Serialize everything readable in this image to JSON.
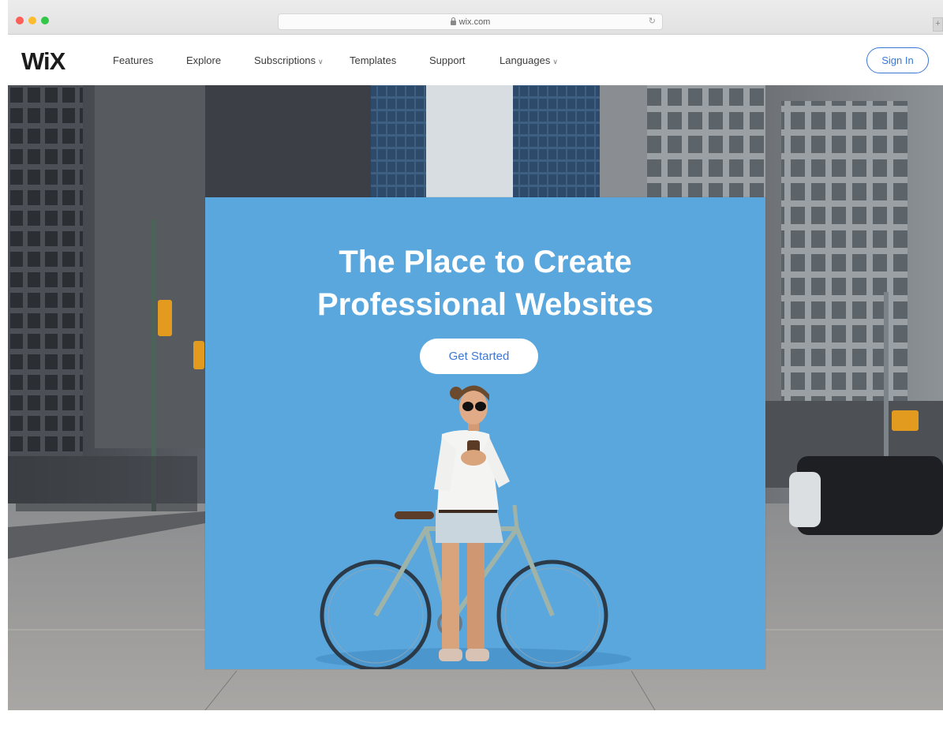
{
  "browser": {
    "url": "wix.com",
    "new_tab_glyph": "+"
  },
  "nav": {
    "logo": "WiX",
    "items": [
      {
        "label": "Features",
        "dropdown": false
      },
      {
        "label": "Explore",
        "dropdown": false
      },
      {
        "label": "Subscriptions",
        "dropdown": true
      },
      {
        "label": "Templates",
        "dropdown": false
      },
      {
        "label": "Support",
        "dropdown": false
      },
      {
        "label": "Languages",
        "dropdown": true
      }
    ],
    "sign_in": "Sign In"
  },
  "hero": {
    "title_line1": "The Place to Create",
    "title_line2": "Professional Websites",
    "cta": "Get Started"
  },
  "colors": {
    "accent": "#3b78d6",
    "hero_panel": "#5aa7de"
  }
}
